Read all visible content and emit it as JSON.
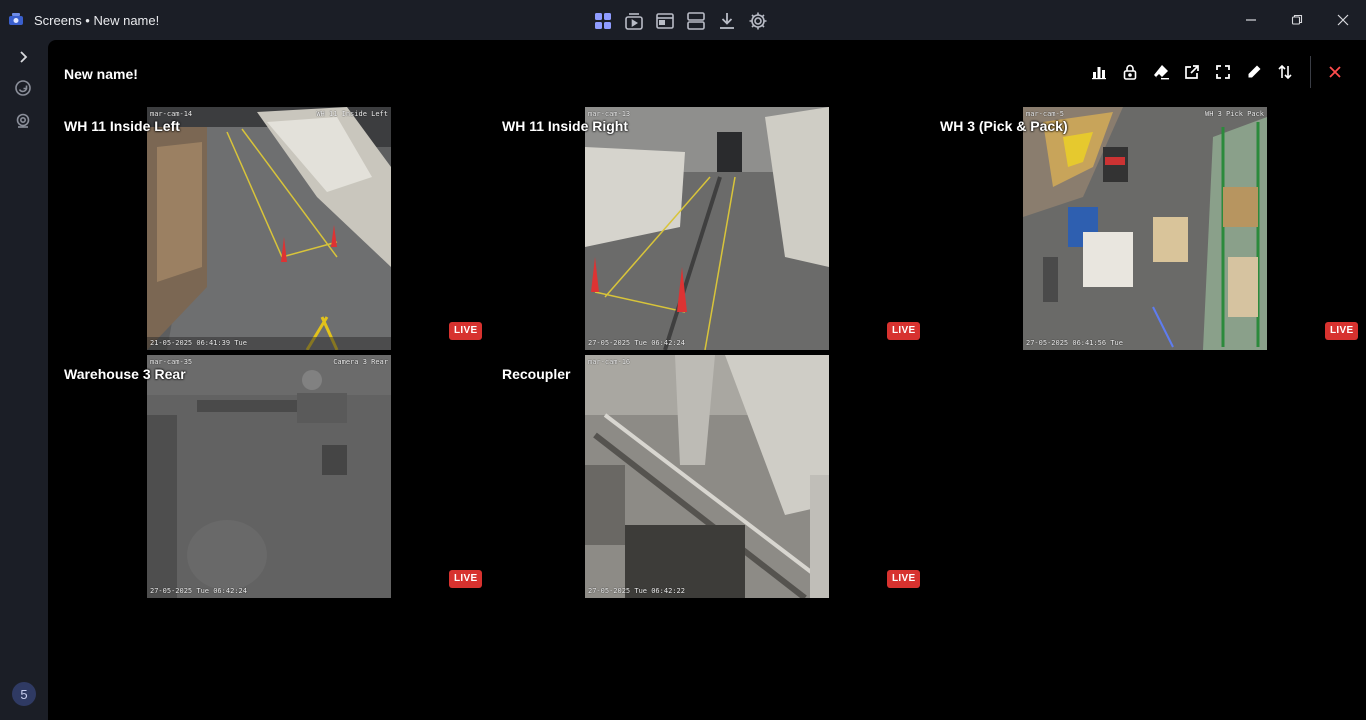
{
  "window": {
    "title": "Screens • New name!",
    "controls": {
      "minimize": "minimize-icon",
      "restore": "restore-icon",
      "close": "close-icon"
    }
  },
  "toolbar": {
    "items": [
      "grid-view-icon",
      "player-icon",
      "window-icon",
      "layout-icon",
      "download-icon",
      "settings-icon"
    ]
  },
  "sidebar": {
    "items": [
      "chevron-right-icon",
      "refresh-icon",
      "camera-icon"
    ],
    "badge": "5"
  },
  "screen": {
    "title": "New name!",
    "actions": [
      "stats-icon",
      "lock-icon",
      "eraser-icon",
      "external-link-icon",
      "fullscreen-icon",
      "edit-icon",
      "sort-icon"
    ],
    "close": "close-icon"
  },
  "cameras": [
    {
      "name": "WH 11 Inside Left",
      "status": "LIVE",
      "overlay_tl": "mar-cam-14",
      "overlay_tr": "WH 11 Inside Left",
      "overlay_bl": "21-05-2025 06:41:39 Tue"
    },
    {
      "name": "WH 11 Inside Right",
      "status": "LIVE",
      "overlay_tl": "mar-cam-13",
      "overlay_tr": "",
      "overlay_bl": "27-05-2025 Tue 06:42:24"
    },
    {
      "name": "WH 3 (Pick & Pack)",
      "status": "LIVE",
      "overlay_tl": "mar-cam-5",
      "overlay_tr": "WH 3 Pick Pack",
      "overlay_bl": "27-05-2025 06:41:56 Tue"
    },
    {
      "name": "Warehouse 3 Rear",
      "status": "LIVE",
      "overlay_tl": "mar-cam-35",
      "overlay_tr": "Camera 3 Rear",
      "overlay_bl": "27-05-2025 Tue 06:42:24"
    },
    {
      "name": "Recoupler",
      "status": "LIVE",
      "overlay_tl": "mar-cam-16",
      "overlay_tr": "",
      "overlay_bl": "27-05-2025 Tue 06:42:22"
    }
  ],
  "colors": {
    "live": "#d7322f",
    "accent": "#8f9cff",
    "background": "#000000",
    "chrome": "#1b1e26"
  }
}
